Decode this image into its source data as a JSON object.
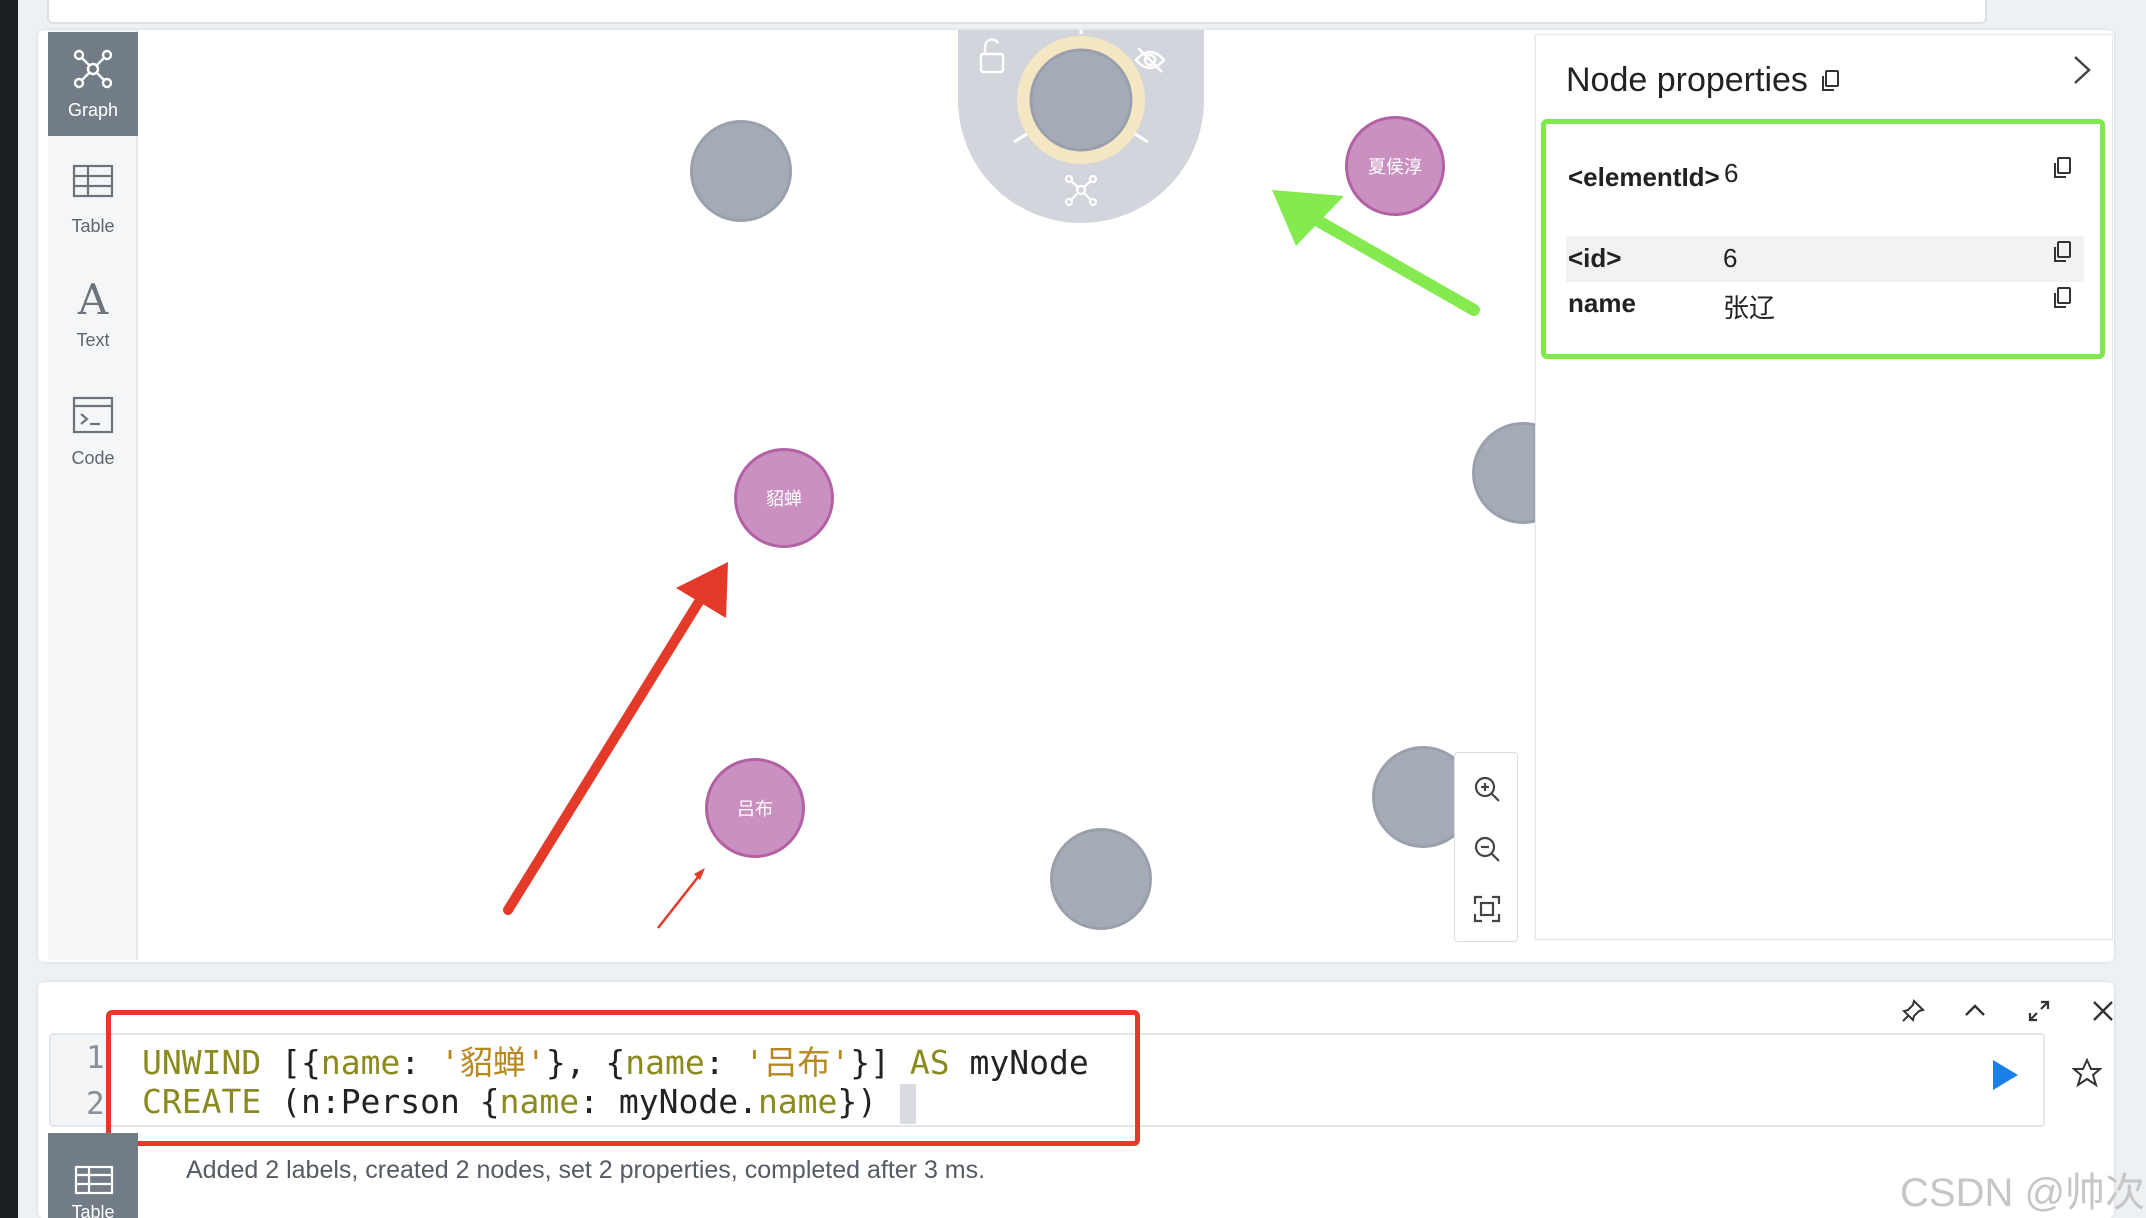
{
  "sidebar": {
    "items": [
      {
        "label": "Graph",
        "icon": "graph-icon",
        "active": true
      },
      {
        "label": "Table",
        "icon": "table-icon",
        "active": false
      },
      {
        "label": "Text",
        "icon": "text-icon",
        "active": false
      },
      {
        "label": "Code",
        "icon": "code-icon",
        "active": false
      }
    ]
  },
  "graph": {
    "nodes": [
      {
        "label": "貂蝉",
        "color": "purple"
      },
      {
        "label": "吕布",
        "color": "purple"
      },
      {
        "label": "夏侯淳",
        "color": "purple"
      }
    ],
    "colors": {
      "gray_node": "#a5abb6",
      "purple_node": "#c990c0",
      "purple_border": "#b261a5"
    }
  },
  "node_properties": {
    "title": "Node properties",
    "rows": [
      {
        "key": "<elementId>",
        "value": "6"
      },
      {
        "key": "<id>",
        "value": "6"
      },
      {
        "key": "name",
        "value": "张辽"
      }
    ]
  },
  "editor": {
    "line_numbers": [
      "1",
      "2"
    ],
    "line1": {
      "kw1": "UNWIND",
      "p1": " [{",
      "k1": "name",
      "p2": ": ",
      "s1": "'貂蝉'",
      "p3": "}, {",
      "k2": "name",
      "p4": ": ",
      "s2": "'吕布'",
      "p5": "}] ",
      "kw2": "AS",
      "p6": " myNode"
    },
    "line2": {
      "kw1": "CREATE",
      "p1": " (n:Person {",
      "k1": "name",
      "p2": ": myNode.",
      "k2": "name",
      "p3": "})"
    },
    "status": "Added 2 labels, created 2 nodes, set 2 properties, completed after 3 ms.",
    "bottom_tab": "Table"
  },
  "watermark": "CSDN @帅次",
  "annotations": {
    "red_box_color": "#e43a2a",
    "green_box_color": "#7fe84c"
  }
}
